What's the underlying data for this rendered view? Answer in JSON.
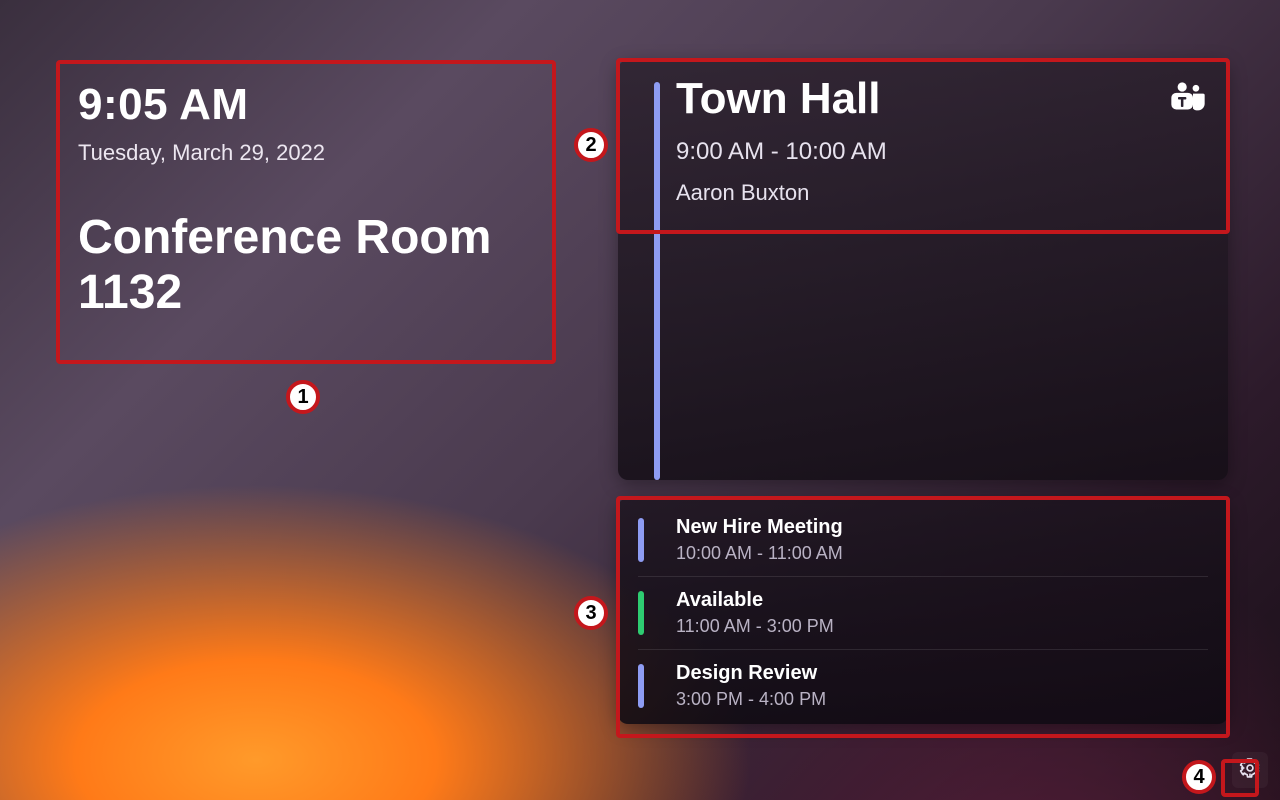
{
  "info": {
    "time": "9:05 AM",
    "date": "Tuesday, March 29, 2022",
    "room": "Conference Room 1132"
  },
  "current_meeting": {
    "title": "Town Hall",
    "time_range": "9:00 AM - 10:00 AM",
    "organizer": "Aaron Buxton",
    "accent": "#8e9cf3"
  },
  "upcoming": [
    {
      "title": "New Hire Meeting",
      "time_range": "10:00 AM - 11:00 AM",
      "status": "busy"
    },
    {
      "title": "Available",
      "time_range": "11:00 AM - 3:00 PM",
      "status": "free"
    },
    {
      "title": "Design Review",
      "time_range": "3:00 PM - 4:00 PM",
      "status": "busy"
    }
  ],
  "colors": {
    "busy": "#8e9cf3",
    "free": "#2ecc71",
    "annotation": "#c4171c"
  },
  "annotations": {
    "n1": "1",
    "n2": "2",
    "n3": "3",
    "n4": "4"
  }
}
